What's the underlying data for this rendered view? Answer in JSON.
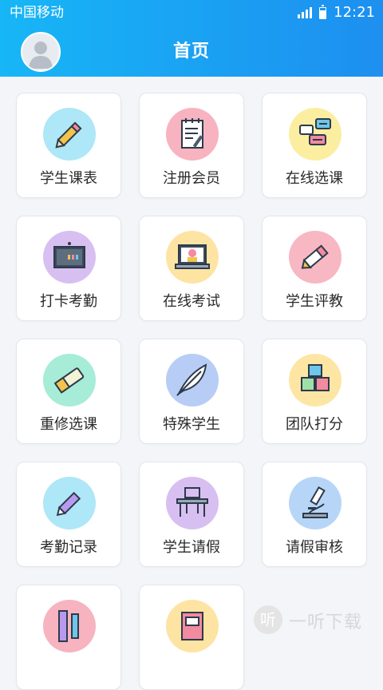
{
  "status_bar": {
    "carrier": "中国移动",
    "time": "12:21"
  },
  "header": {
    "title": "首页"
  },
  "menu": [
    {
      "label": "学生课表",
      "icon": "pencil-icon",
      "color": "#aee7f7"
    },
    {
      "label": "注册会员",
      "icon": "notepad-icon",
      "color": "#f7b3c0"
    },
    {
      "label": "在线选课",
      "icon": "chat-bubbles-icon",
      "color": "#fbeea1"
    },
    {
      "label": "打卡考勤",
      "icon": "blackboard-icon",
      "color": "#d8bff1"
    },
    {
      "label": "在线考试",
      "icon": "laptop-icon",
      "color": "#fde4a3"
    },
    {
      "label": "学生评教",
      "icon": "marker-icon",
      "color": "#f7b7c3"
    },
    {
      "label": "重修选课",
      "icon": "eraser-icon",
      "color": "#a6ecd7"
    },
    {
      "label": "特殊学生",
      "icon": "feather-icon",
      "color": "#b7cdf5"
    },
    {
      "label": "团队打分",
      "icon": "number-blocks-icon",
      "color": "#fde6a4"
    },
    {
      "label": "考勤记录",
      "icon": "pen-icon",
      "color": "#aee7f7"
    },
    {
      "label": "学生请假",
      "icon": "desk-icon",
      "color": "#d8bff1"
    },
    {
      "label": "请假审核",
      "icon": "microscope-icon",
      "color": "#b7d6f7"
    },
    {
      "label": "",
      "icon": "ruler-pencil-icon",
      "color": "#f7b3c0"
    },
    {
      "label": "",
      "icon": "book-icon",
      "color": "#fde4a3"
    }
  ],
  "watermark": {
    "logo": "听",
    "text": "一听下载"
  }
}
